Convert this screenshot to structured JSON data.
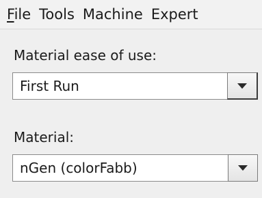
{
  "menubar": {
    "items": [
      {
        "mnemonic": "F",
        "rest": "ile"
      },
      {
        "label": "Tools"
      },
      {
        "label": "Machine"
      },
      {
        "label": "Expert"
      }
    ]
  },
  "settings": {
    "ease_label": "Material ease of use:",
    "ease_value": "First Run",
    "material_label": "Material:",
    "material_value": "nGen (colorFabb)"
  },
  "icons": {
    "dropdown": "chevron-down-icon"
  },
  "colors": {
    "window_bg": "#efefef",
    "field_bg": "#ffffff",
    "border": "#8a8a8a"
  }
}
